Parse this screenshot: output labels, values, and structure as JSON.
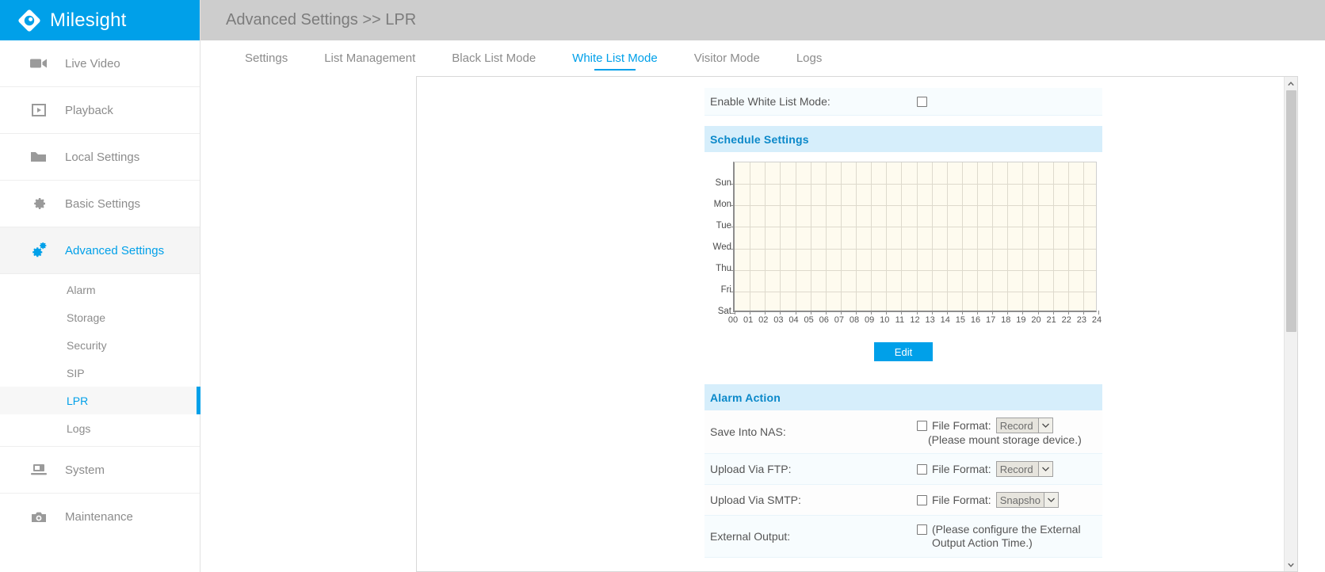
{
  "brand": {
    "name": "Milesight",
    "logo_icon": "milesight-diamond-logo",
    "accent": "#00a0e9"
  },
  "sidebar": {
    "items": [
      {
        "label": "Live Video",
        "icon": "video-camera-icon",
        "active": false
      },
      {
        "label": "Playback",
        "icon": "play-box-icon",
        "active": false
      },
      {
        "label": "Local Settings",
        "icon": "folder-icon",
        "active": false
      },
      {
        "label": "Basic Settings",
        "icon": "gear-icon",
        "active": false
      },
      {
        "label": "Advanced Settings",
        "icon": "double-gear-icon",
        "active": true
      },
      {
        "label": "System",
        "icon": "monitor-icon",
        "active": false
      },
      {
        "label": "Maintenance",
        "icon": "camera-icon",
        "active": false
      }
    ],
    "subitems": [
      {
        "label": "Alarm",
        "active": false
      },
      {
        "label": "Storage",
        "active": false
      },
      {
        "label": "Security",
        "active": false
      },
      {
        "label": "SIP",
        "active": false
      },
      {
        "label": "LPR",
        "active": true
      },
      {
        "label": "Logs",
        "active": false
      }
    ]
  },
  "header": {
    "breadcrumb": "Advanced Settings >> LPR"
  },
  "tabs": [
    {
      "label": "Settings",
      "active": false
    },
    {
      "label": "List Management",
      "active": false
    },
    {
      "label": "Black List Mode",
      "active": false
    },
    {
      "label": "White List Mode",
      "active": true
    },
    {
      "label": "Visitor Mode",
      "active": false
    },
    {
      "label": "Logs",
      "active": false
    }
  ],
  "form": {
    "enable_label": "Enable White List Mode:",
    "enable_checked": false,
    "schedule_section_title": "Schedule Settings",
    "edit_button": "Edit",
    "alarm_section_title": "Alarm Action",
    "file_format_label": "File Format:",
    "rows": [
      {
        "label": "Save Into NAS:",
        "checked": false,
        "format_label": "File Format:",
        "format_value": "Record",
        "hint": "(Please mount storage device.)"
      },
      {
        "label": "Upload Via FTP:",
        "checked": false,
        "format_label": "File Format:",
        "format_value": "Record",
        "hint": ""
      },
      {
        "label": "Upload Via SMTP:",
        "checked": false,
        "format_label": "File Format:",
        "format_value": "Snapsho",
        "hint": ""
      },
      {
        "label": "External Output:",
        "checked": false,
        "format_label": "",
        "format_value": "",
        "hint": "(Please configure the External Output Action Time.)"
      }
    ]
  },
  "chart_data": {
    "type": "heatmap",
    "title": "Schedule Settings",
    "xlabel": "",
    "ylabel": "",
    "categories": [
      "Sun",
      "Mon",
      "Tue",
      "Wed",
      "Thu",
      "Fri",
      "Sat"
    ],
    "x": [
      "00",
      "01",
      "02",
      "03",
      "04",
      "05",
      "06",
      "07",
      "08",
      "09",
      "10",
      "11",
      "12",
      "13",
      "14",
      "15",
      "16",
      "17",
      "18",
      "19",
      "20",
      "21",
      "22",
      "23",
      "24"
    ],
    "xlim": [
      0,
      24
    ],
    "grid": true,
    "legend": "none",
    "plot_bg": "#fefbef",
    "selected_cells": [],
    "series": [
      {
        "name": "Sun",
        "values": [
          0,
          0,
          0,
          0,
          0,
          0,
          0,
          0,
          0,
          0,
          0,
          0,
          0,
          0,
          0,
          0,
          0,
          0,
          0,
          0,
          0,
          0,
          0,
          0
        ]
      },
      {
        "name": "Mon",
        "values": [
          0,
          0,
          0,
          0,
          0,
          0,
          0,
          0,
          0,
          0,
          0,
          0,
          0,
          0,
          0,
          0,
          0,
          0,
          0,
          0,
          0,
          0,
          0,
          0
        ]
      },
      {
        "name": "Tue",
        "values": [
          0,
          0,
          0,
          0,
          0,
          0,
          0,
          0,
          0,
          0,
          0,
          0,
          0,
          0,
          0,
          0,
          0,
          0,
          0,
          0,
          0,
          0,
          0,
          0
        ]
      },
      {
        "name": "Wed",
        "values": [
          0,
          0,
          0,
          0,
          0,
          0,
          0,
          0,
          0,
          0,
          0,
          0,
          0,
          0,
          0,
          0,
          0,
          0,
          0,
          0,
          0,
          0,
          0,
          0
        ]
      },
      {
        "name": "Thu",
        "values": [
          0,
          0,
          0,
          0,
          0,
          0,
          0,
          0,
          0,
          0,
          0,
          0,
          0,
          0,
          0,
          0,
          0,
          0,
          0,
          0,
          0,
          0,
          0,
          0
        ]
      },
      {
        "name": "Fri",
        "values": [
          0,
          0,
          0,
          0,
          0,
          0,
          0,
          0,
          0,
          0,
          0,
          0,
          0,
          0,
          0,
          0,
          0,
          0,
          0,
          0,
          0,
          0,
          0,
          0
        ]
      },
      {
        "name": "Sat",
        "values": [
          0,
          0,
          0,
          0,
          0,
          0,
          0,
          0,
          0,
          0,
          0,
          0,
          0,
          0,
          0,
          0,
          0,
          0,
          0,
          0,
          0,
          0,
          0,
          0
        ]
      }
    ]
  },
  "scrollbar": {
    "up_icon": "chevron-up-icon",
    "down_icon": "chevron-down-icon"
  }
}
